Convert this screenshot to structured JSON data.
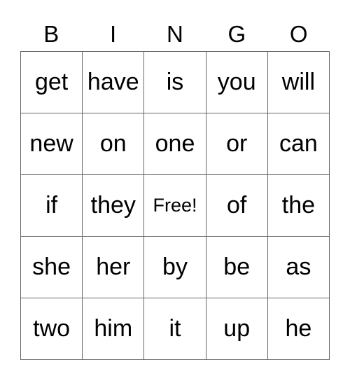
{
  "header": [
    "B",
    "I",
    "N",
    "G",
    "O"
  ],
  "rows": [
    [
      "get",
      "have",
      "is",
      "you",
      "will"
    ],
    [
      "new",
      "on",
      "one",
      "or",
      "can"
    ],
    [
      "if",
      "they",
      "Free!",
      "of",
      "the"
    ],
    [
      "she",
      "her",
      "by",
      "be",
      "as"
    ],
    [
      "two",
      "him",
      "it",
      "up",
      "he"
    ]
  ],
  "free_cell": {
    "row": 2,
    "col": 2
  }
}
